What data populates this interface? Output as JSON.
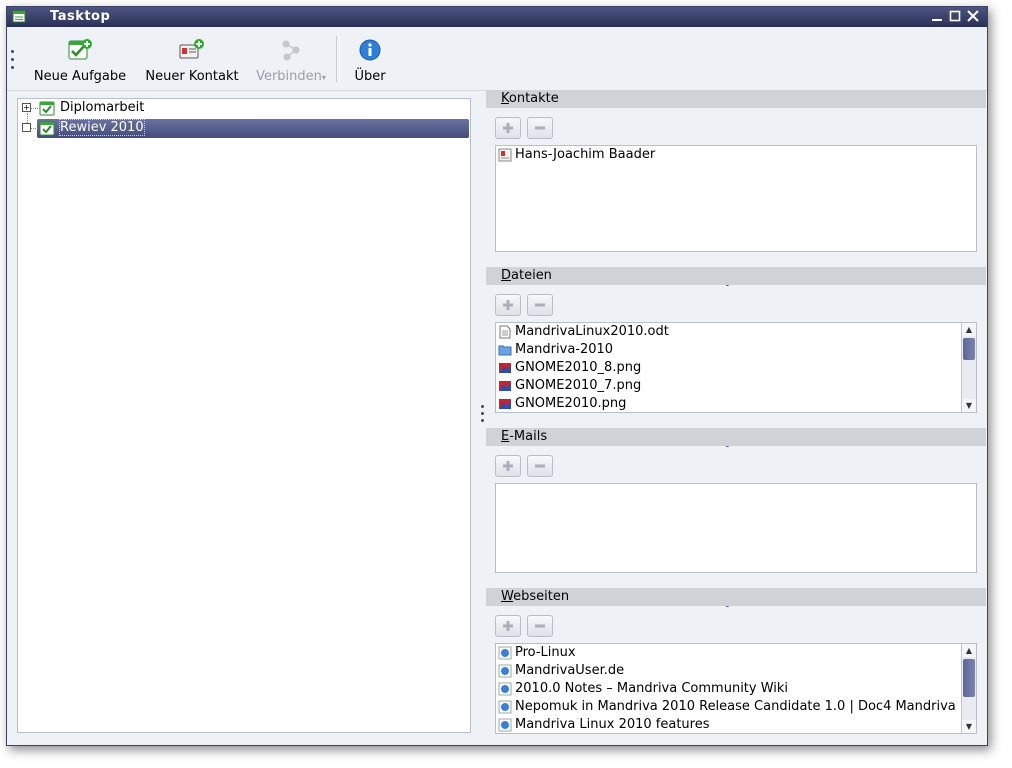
{
  "window": {
    "title": "Tasktop"
  },
  "toolbar": {
    "new_task": "Neue Aufgabe",
    "new_contact": "Neuer Kontakt",
    "connect": "Verbinden",
    "about": "Über"
  },
  "tree": {
    "items": [
      {
        "label": "Diplomarbeit",
        "expander": "+"
      },
      {
        "label": "Rewiev 2010",
        "expander": "",
        "selected": true
      }
    ]
  },
  "sections": {
    "contacts": {
      "title_first": "K",
      "title_rest": "ontakte",
      "items": [
        {
          "label": "Hans-Joachim Baader",
          "icon": "contact-card-icon"
        }
      ]
    },
    "files": {
      "title_first": "D",
      "title_rest": "ateien",
      "items": [
        {
          "label": "MandrivaLinux2010.odt",
          "icon": "document-icon"
        },
        {
          "label": "Mandriva-2010",
          "icon": "folder-icon"
        },
        {
          "label": "GNOME2010_8.png",
          "icon": "image-icon"
        },
        {
          "label": "GNOME2010_7.png",
          "icon": "image-icon"
        },
        {
          "label": "GNOME2010.png",
          "icon": "image-icon"
        }
      ]
    },
    "emails": {
      "title_first": "E",
      "title_rest": "-Mails",
      "items": []
    },
    "websites": {
      "title_first": "W",
      "title_rest": "ebseiten",
      "items": [
        {
          "label": "Pro-Linux",
          "icon": "web-link-icon"
        },
        {
          "label": "MandrivaUser.de",
          "icon": "web-link-icon"
        },
        {
          "label": "2010.0 Notes – Mandriva Community Wiki",
          "icon": "web-link-icon"
        },
        {
          "label": "Nepomuk in Mandriva 2010 Release Candidate 1.0 | Doc4 Mandriva",
          "icon": "web-link-icon"
        },
        {
          "label": "Mandriva Linux 2010 features",
          "icon": "web-link-icon"
        }
      ]
    }
  },
  "colors": {
    "accent": "#434b7a",
    "titlebar": "#2a3058",
    "background": "#eef2f6"
  }
}
